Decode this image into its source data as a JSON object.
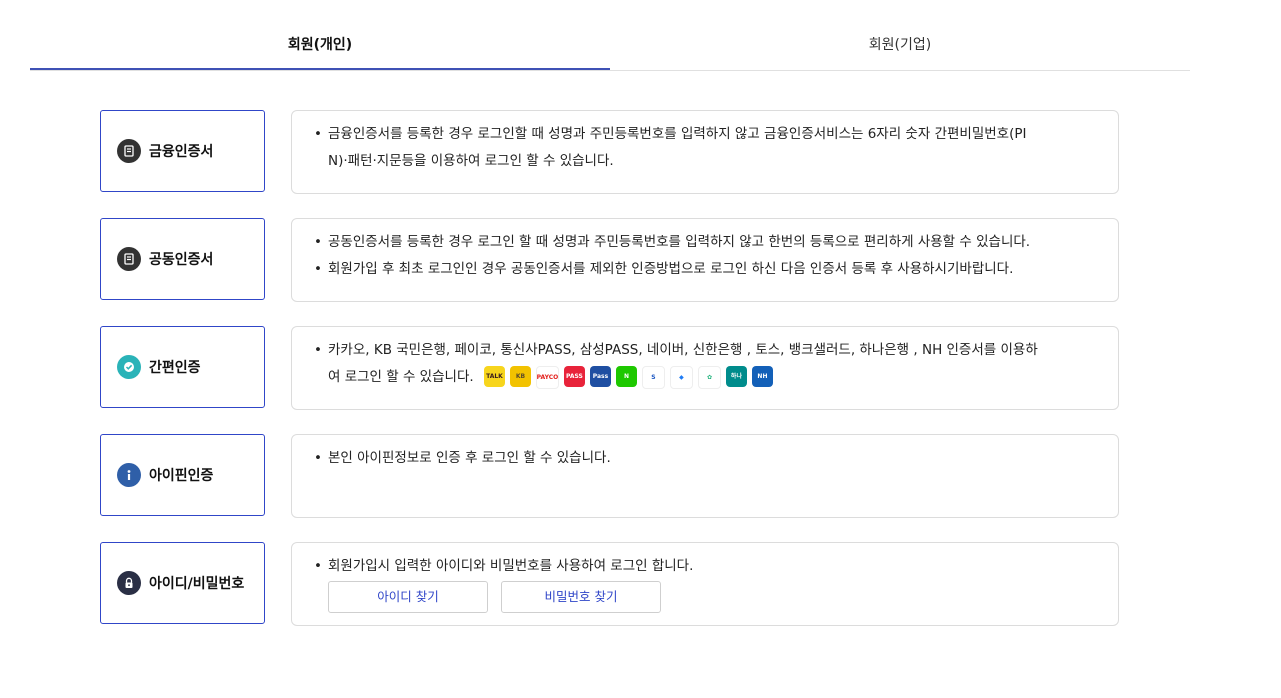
{
  "tabs": [
    {
      "label": "회원(개인)",
      "active": true
    },
    {
      "label": "회원(기업)",
      "active": false
    }
  ],
  "methods": [
    {
      "label": "금융인증서",
      "icon": "financial-cert-icon",
      "desc": [
        "금융인증서를 등록한 경우 로그인할 때 성명과 주민등록번호를 입력하지 않고 금융인증서비스는 6자리 숫자 간편비밀번호(PI",
        "N)·패턴·지문등을 이용하여 로그인 할 수 있습니다."
      ]
    },
    {
      "label": "공동인증서",
      "icon": "joint-cert-icon",
      "desc": [
        "공동인증서를 등록한 경우 로그인 할 때 성명과 주민등록번호를 입력하지 않고 한번의 등록으로 편리하게 사용할 수 있습니다.",
        "회원가입 후 최초 로그인인 경우 공동인증서를 제외한 인증방법으로 로그인 하신 다음 인증서 등록 후 사용하시기바랍니다."
      ]
    },
    {
      "label": "간편인증",
      "icon": "simple-auth-icon",
      "desc": [
        "카카오, KB 국민은행, 페이코, 통신사PASS, 삼성PASS, 네이버, 신한은행 , 토스, 뱅크샐러드, 하나은행 , NH 인증서를 이용하",
        "여 로그인 할 수 있습니다."
      ],
      "apps": [
        {
          "name": "kakao-icon",
          "text": "TALK",
          "bg": "#f7d51d",
          "fg": "#3a1d1d"
        },
        {
          "name": "kb-icon",
          "text": "KB",
          "bg": "#f2c200",
          "fg": "#5a4a2b"
        },
        {
          "name": "payco-icon",
          "text": "PAYCO",
          "bg": "#ffffff",
          "fg": "#e4211d"
        },
        {
          "name": "pass-icon",
          "text": "PASS",
          "bg": "#e8233a",
          "fg": "#ffffff"
        },
        {
          "name": "samsung-pass-icon",
          "text": "Pass",
          "bg": "#1f4fa2",
          "fg": "#ffffff"
        },
        {
          "name": "naver-icon",
          "text": "N",
          "bg": "#1ec800",
          "fg": "#ffffff"
        },
        {
          "name": "shinhan-icon",
          "text": "S",
          "bg": "#ffffff",
          "fg": "#1a56c2"
        },
        {
          "name": "toss-icon",
          "text": "◆",
          "bg": "#ffffff",
          "fg": "#1f7cf5"
        },
        {
          "name": "banksalad-icon",
          "text": "✿",
          "bg": "#ffffff",
          "fg": "#24b47e"
        },
        {
          "name": "hana-icon",
          "text": "하나",
          "bg": "#008c8c",
          "fg": "#ffffff"
        },
        {
          "name": "nh-icon",
          "text": "NH",
          "bg": "#1360b8",
          "fg": "#ffffff"
        }
      ]
    },
    {
      "label": "아이핀인증",
      "icon": "ipin-icon",
      "desc": [
        "본인 아이핀정보로 인증 후 로그인 할 수 있습니다."
      ]
    },
    {
      "label": "아이디/비밀번호",
      "icon": "lock-icon",
      "desc": [
        "회원가입시 입력한 아이디와 비밀번호를 사용하여 로그인 합니다."
      ],
      "buttons": [
        "아이디 찾기",
        "비밀번호 찾기"
      ]
    }
  ],
  "colors": {
    "accent": "#3046c8",
    "border": "#dcdcdc"
  }
}
